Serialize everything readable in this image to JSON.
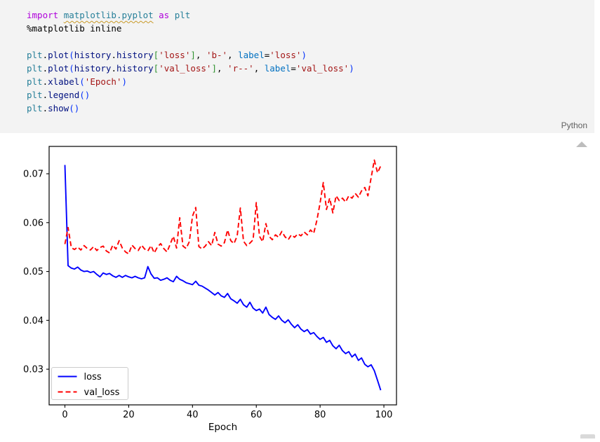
{
  "code_cell": {
    "language_label": "Python",
    "lines": [
      [
        {
          "t": "import",
          "c": "kw"
        },
        {
          "t": " "
        },
        {
          "t": "matplotlib.pyplot",
          "c": "mod",
          "u": true
        },
        {
          "t": " "
        },
        {
          "t": "as",
          "c": "kw"
        },
        {
          "t": " "
        },
        {
          "t": "plt",
          "c": "mod"
        }
      ],
      [
        {
          "t": "%matplotlib inline"
        }
      ],
      [],
      [
        {
          "t": "plt",
          "c": "mod"
        },
        {
          "t": "."
        },
        {
          "t": "plot",
          "c": "fn"
        },
        {
          "t": "(",
          "c": "br1"
        },
        {
          "t": "history",
          "c": "var"
        },
        {
          "t": "."
        },
        {
          "t": "history",
          "c": "var"
        },
        {
          "t": "[",
          "c": "br2"
        },
        {
          "t": "'loss'",
          "c": "str"
        },
        {
          "t": "]",
          "c": "br2"
        },
        {
          "t": ", "
        },
        {
          "t": "'b-'",
          "c": "str"
        },
        {
          "t": ", "
        },
        {
          "t": "label",
          "c": "param"
        },
        {
          "t": "="
        },
        {
          "t": "'loss'",
          "c": "str"
        },
        {
          "t": ")",
          "c": "br1"
        }
      ],
      [
        {
          "t": "plt",
          "c": "mod"
        },
        {
          "t": "."
        },
        {
          "t": "plot",
          "c": "fn"
        },
        {
          "t": "(",
          "c": "br1"
        },
        {
          "t": "history",
          "c": "var"
        },
        {
          "t": "."
        },
        {
          "t": "history",
          "c": "var"
        },
        {
          "t": "[",
          "c": "br2"
        },
        {
          "t": "'val_loss'",
          "c": "str"
        },
        {
          "t": "]",
          "c": "br2"
        },
        {
          "t": ", "
        },
        {
          "t": "'r--'",
          "c": "str"
        },
        {
          "t": ", "
        },
        {
          "t": "label",
          "c": "param"
        },
        {
          "t": "="
        },
        {
          "t": "'val_loss'",
          "c": "str"
        },
        {
          "t": ")",
          "c": "br1"
        }
      ],
      [
        {
          "t": "plt",
          "c": "mod"
        },
        {
          "t": "."
        },
        {
          "t": "xlabel",
          "c": "fn"
        },
        {
          "t": "(",
          "c": "br1"
        },
        {
          "t": "'Epoch'",
          "c": "str"
        },
        {
          "t": ")",
          "c": "br1"
        }
      ],
      [
        {
          "t": "plt",
          "c": "mod"
        },
        {
          "t": "."
        },
        {
          "t": "legend",
          "c": "fn"
        },
        {
          "t": "(",
          "c": "br1"
        },
        {
          "t": ")",
          "c": "br1"
        }
      ],
      [
        {
          "t": "plt",
          "c": "mod"
        },
        {
          "t": "."
        },
        {
          "t": "show",
          "c": "fn"
        },
        {
          "t": "(",
          "c": "br1"
        },
        {
          "t": ")",
          "c": "br1"
        }
      ]
    ]
  },
  "output": {
    "scroll_up_icon": "up-triangle",
    "scroll_down_icon": "partial-chip"
  },
  "chart_data": {
    "type": "line",
    "title": "",
    "xlabel": "Epoch",
    "ylabel": "",
    "x_start": 0,
    "x_step": 1,
    "xlim": [
      -4.95,
      103.95
    ],
    "ylim": [
      0.0227,
      0.0756
    ],
    "xticks": [
      0,
      20,
      40,
      60,
      80,
      100
    ],
    "yticks": [
      0.03,
      0.04,
      0.05,
      0.06,
      0.07
    ],
    "grid": false,
    "legend_position": "lower left",
    "series": [
      {
        "name": "loss",
        "color": "#0000ff",
        "line_style": "solid",
        "values": [
          0.0718,
          0.0512,
          0.0507,
          0.0505,
          0.0509,
          0.0503,
          0.05,
          0.0501,
          0.0498,
          0.05,
          0.0494,
          0.0489,
          0.0497,
          0.0494,
          0.0496,
          0.0491,
          0.0488,
          0.0492,
          0.0488,
          0.0492,
          0.0489,
          0.0487,
          0.049,
          0.0487,
          0.0485,
          0.0487,
          0.051,
          0.0495,
          0.0486,
          0.0487,
          0.0482,
          0.0484,
          0.0487,
          0.0482,
          0.0479,
          0.049,
          0.0484,
          0.0481,
          0.0477,
          0.0475,
          0.0473,
          0.048,
          0.0472,
          0.047,
          0.0466,
          0.0462,
          0.0457,
          0.0452,
          0.0457,
          0.045,
          0.0447,
          0.0455,
          0.0444,
          0.044,
          0.0435,
          0.0443,
          0.0432,
          0.0427,
          0.0437,
          0.0425,
          0.042,
          0.0423,
          0.0415,
          0.0427,
          0.0412,
          0.0406,
          0.0402,
          0.0409,
          0.04,
          0.0395,
          0.0401,
          0.0392,
          0.0385,
          0.0391,
          0.0382,
          0.0377,
          0.0381,
          0.0372,
          0.0375,
          0.0367,
          0.0361,
          0.0365,
          0.0355,
          0.0359,
          0.0348,
          0.0342,
          0.0349,
          0.0338,
          0.0332,
          0.0336,
          0.0325,
          0.0331,
          0.0318,
          0.0323,
          0.031,
          0.0305,
          0.0309,
          0.0297,
          0.0277,
          0.0257
        ]
      },
      {
        "name": "val_loss",
        "color": "#ff0000",
        "line_style": "dashed",
        "values": [
          0.0556,
          0.059,
          0.0549,
          0.0545,
          0.055,
          0.0544,
          0.0553,
          0.0547,
          0.0544,
          0.0551,
          0.0543,
          0.0549,
          0.0552,
          0.0542,
          0.0538,
          0.0554,
          0.0546,
          0.0563,
          0.0548,
          0.054,
          0.0536,
          0.0554,
          0.0547,
          0.0543,
          0.0554,
          0.0546,
          0.0542,
          0.0553,
          0.0538,
          0.055,
          0.0557,
          0.0547,
          0.054,
          0.0556,
          0.0572,
          0.0548,
          0.061,
          0.0552,
          0.0547,
          0.0561,
          0.0613,
          0.0631,
          0.0551,
          0.0546,
          0.0552,
          0.0561,
          0.0553,
          0.058,
          0.0556,
          0.0552,
          0.0559,
          0.0585,
          0.0563,
          0.0557,
          0.0573,
          0.063,
          0.0562,
          0.0553,
          0.0558,
          0.0565,
          0.0641,
          0.0572,
          0.0561,
          0.0598,
          0.0572,
          0.0565,
          0.0575,
          0.057,
          0.0582,
          0.0571,
          0.0565,
          0.0575,
          0.057,
          0.0577,
          0.0573,
          0.0581,
          0.0575,
          0.0585,
          0.0578,
          0.0605,
          0.064,
          0.0682,
          0.0627,
          0.065,
          0.062,
          0.0655,
          0.0645,
          0.065,
          0.0642,
          0.0655,
          0.065,
          0.066,
          0.0652,
          0.0665,
          0.0672,
          0.0655,
          0.0692,
          0.0728,
          0.0702,
          0.0716
        ]
      }
    ]
  }
}
